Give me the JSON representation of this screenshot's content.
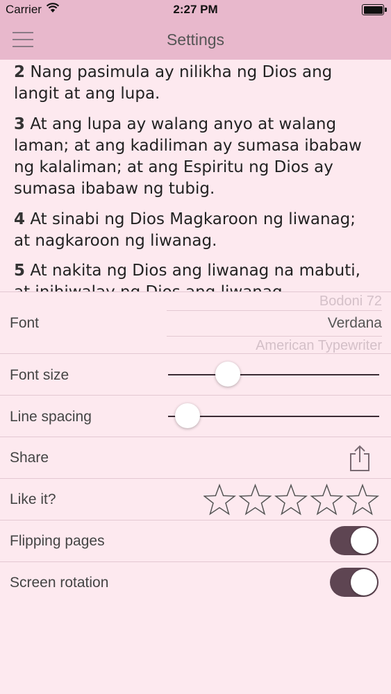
{
  "status_bar": {
    "carrier": "Carrier",
    "time": "2:27 PM",
    "wifi_icon": "wifi-icon",
    "battery_icon": "battery-icon"
  },
  "nav": {
    "title": "Settings",
    "menu_icon": "hamburger-menu-icon"
  },
  "verses": [
    {
      "num": "2",
      "text": "Nang pasimula ay nilikha ng Dios ang langit at ang lupa."
    },
    {
      "num": "3",
      "text": "At ang lupa ay walang anyo at walang laman; at ang kadiliman ay sumasa ibabaw ng kalaliman; at ang Espiritu ng Dios ay sumasa ibabaw ng tubig."
    },
    {
      "num": "4",
      "text": "At sinabi ng Dios Magkaroon ng liwanag; at nagkaroon ng liwanag."
    },
    {
      "num": "5",
      "text": "At nakita ng Dios ang liwanag na mabuti, at inihiwalay ng Dios ang liwanag"
    }
  ],
  "settings": {
    "font": {
      "label": "Font",
      "options": [
        "Bodoni 72",
        "Verdana",
        "American Typewriter"
      ],
      "selected": "Verdana"
    },
    "font_size": {
      "label": "Font size",
      "value": 0.25
    },
    "line_spacing": {
      "label": "Line spacing",
      "value": 0.06
    },
    "share": {
      "label": "Share",
      "icon": "share-icon"
    },
    "like": {
      "label": "Like it?",
      "stars": 5,
      "rating": 0
    },
    "flipping_pages": {
      "label": "Flipping pages",
      "on": true
    },
    "screen_rotation": {
      "label": "Screen rotation",
      "on": true
    }
  },
  "colors": {
    "header": "#e8b8cc",
    "background": "#fde9ef",
    "toggle_on": "#5e4552"
  }
}
